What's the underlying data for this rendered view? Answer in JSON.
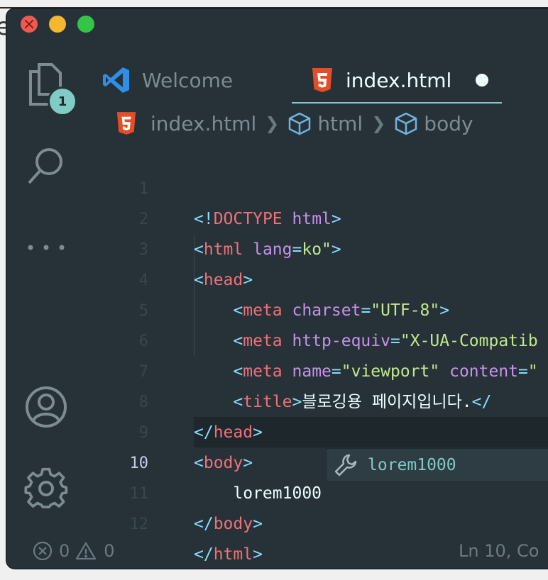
{
  "tabs": [
    {
      "label": "Welcome",
      "icon": "vscode-icon"
    },
    {
      "label": "index.html",
      "icon": "html5-icon",
      "modified": true
    }
  ],
  "activity": {
    "explorer_badge": "1"
  },
  "breadcrumb": {
    "file": "index.html",
    "crumbs": [
      "html",
      "body"
    ]
  },
  "code": {
    "line_numbers": [
      "1",
      "2",
      "3",
      "4",
      "5",
      "6",
      "7",
      "8",
      "9",
      "10",
      "11",
      "12"
    ],
    "active_line": "10",
    "l1": {
      "open": "<!",
      "tag": "DOCTYPE",
      "attr": "html",
      "close": ">"
    },
    "l2": {
      "open": "<",
      "tag": "html",
      "attr": "lang",
      "eq": "=",
      "val": "ko\"",
      "close": ">"
    },
    "l3": {
      "open": "<",
      "tag": "head",
      "close": ">"
    },
    "l4": {
      "open": "<",
      "tag": "meta",
      "attr": "charset",
      "eq": "=",
      "q1": "\"",
      "val": "UTF-8",
      "q2": "\"",
      "close": ">"
    },
    "l5": {
      "open": "<",
      "tag": "meta",
      "attr": "http-equiv",
      "eq": "=",
      "q1": "\"",
      "val": "X-UA-Compatib"
    },
    "l6": {
      "open": "<",
      "tag": "meta",
      "attr": "name",
      "eq": "=",
      "q1": "\"",
      "val": "viewport",
      "q2": "\"",
      "attr2": "content",
      "eq2": "=",
      "q3": "\""
    },
    "l7": {
      "open": "<",
      "tag": "title",
      "close": ">",
      "text": "블로깅용 페이지입니다.",
      "open2": "</"
    },
    "l8": {
      "open": "</",
      "tag": "head",
      "close": ">"
    },
    "l9": {
      "open": "<",
      "tag": "body",
      "close": ">"
    },
    "l10": {
      "text": "lorem1000"
    },
    "l11": {
      "open": "</",
      "tag": "body",
      "close": ">"
    },
    "l12": {
      "open": "</",
      "tag": "html",
      "close": ">"
    }
  },
  "suggestion": {
    "label": "lorem1000",
    "icon": "wrench-icon"
  },
  "status": {
    "errors": "0",
    "warnings": "0",
    "position": "Ln 10, Co"
  },
  "colors": {
    "bg": "#263238",
    "tag": "#f07178",
    "punct": "#89ddff",
    "attr": "#c792ea",
    "string": "#c3e88d",
    "accent": "#80cbc4"
  }
}
